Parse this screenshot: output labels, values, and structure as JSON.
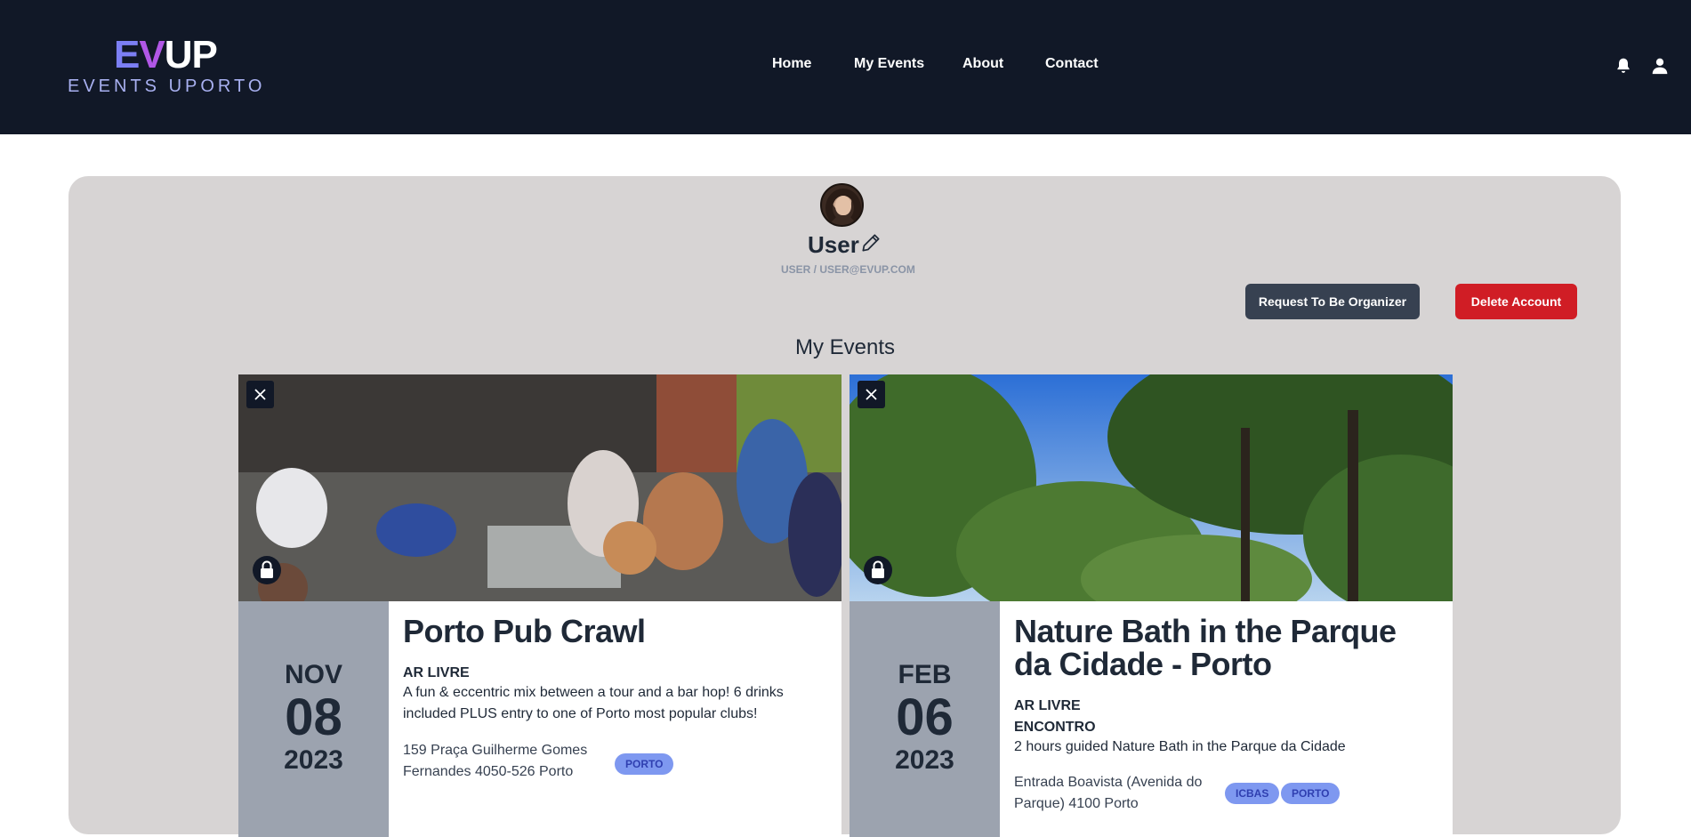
{
  "brand": {
    "logo_e": "E",
    "logo_v": "V",
    "logo_up": "UP",
    "subtitle": "EVENTS UPORTO"
  },
  "nav": {
    "home": "Home",
    "my_events": "My Events",
    "about": "About",
    "contact": "Contact"
  },
  "header_icons": [
    "bell-icon",
    "user-icon"
  ],
  "profile": {
    "name": "User",
    "subtitle": "USER / USER@EVUP.COM",
    "request_organizer_label": "Request To Be Organizer",
    "delete_account_label": "Delete Account"
  },
  "section": {
    "title": "My Events"
  },
  "events": [
    {
      "month": "NOV",
      "day": "08",
      "year": "2023",
      "title": "Porto Pub Crawl",
      "tags": [
        "AR LIVRE"
      ],
      "description": "A fun & eccentric mix between a tour and a bar hop! 6 drinks included PLUS entry to one of Porto most popular clubs!",
      "location": "159 Praça Guilherme Gomes Fernandes 4050-526 Porto",
      "badges": [
        "PORTO"
      ]
    },
    {
      "month": "FEB",
      "day": "06",
      "year": "2023",
      "title": "Nature Bath in the Parque da Cidade - Porto",
      "tags": [
        "AR LIVRE",
        "ENCONTRO"
      ],
      "description": "2 hours guided Nature Bath in the Parque da Cidade",
      "location": "Entrada Boavista (Avenida do Parque) 4100 Porto",
      "badges": [
        "ICBAS",
        "PORTO"
      ]
    }
  ],
  "colors": {
    "header_bg": "#111827",
    "card_bg": "#d7d4d4",
    "organizer_button": "#374151",
    "delete_button": "#d01d25",
    "badge_bg": "#7e98f0",
    "date_column": "#9ca3af"
  }
}
